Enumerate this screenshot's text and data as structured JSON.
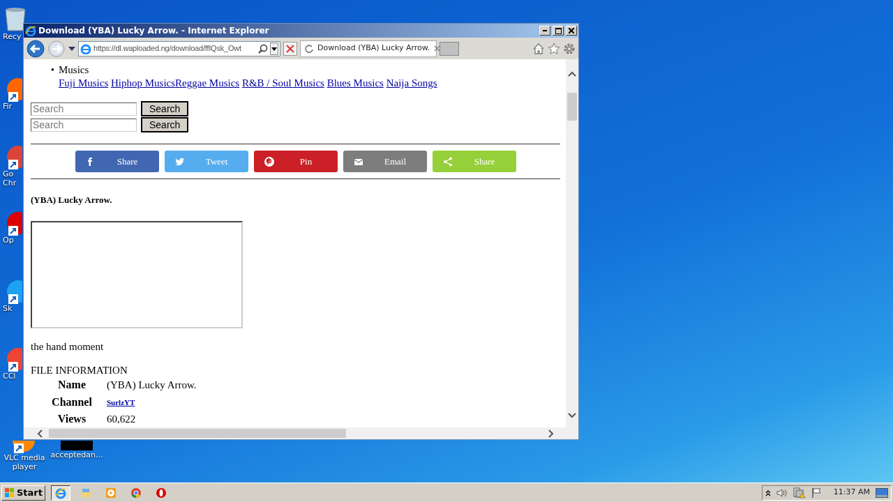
{
  "desktop_icons": [
    {
      "kind": "recycle",
      "lines": [
        "Recy"
      ]
    },
    {
      "kind": "firefox",
      "lines": [
        "Fir"
      ]
    },
    {
      "kind": "chrome",
      "lines": [
        "Go",
        "Chr"
      ]
    },
    {
      "kind": "opera",
      "lines": [
        "Op"
      ]
    },
    {
      "kind": "skype",
      "lines": [
        "Sk"
      ]
    },
    {
      "kind": "ccleaner",
      "lines": [
        "CCl"
      ]
    },
    {
      "kind": "vlc",
      "lines": [
        "VLC media",
        "player"
      ]
    },
    {
      "kind": "file",
      "lines": [
        "acceptedan..."
      ]
    }
  ],
  "window": {
    "title": "Download (YBA) Lucky Arrow. - Internet Explorer",
    "address": "https://dl.waploaded.ng/download/ffIQsk_Owt",
    "tabs": [
      {
        "label": "Download (YBA) Lucky Arrow.",
        "selected": true
      }
    ]
  },
  "page": {
    "menu": {
      "bullet": "•",
      "label": "Musics",
      "links": [
        {
          "text": "Fuji Musics",
          "joined": false
        },
        {
          "text": "Hiphop Musics",
          "joined": false
        },
        {
          "text": "Reggae Musics",
          "joined": true
        },
        {
          "text": "R&B / Soul Musics",
          "joined": false
        },
        {
          "text": "Blues Musics",
          "joined": false
        },
        {
          "text": "Naija Songs",
          "joined": false
        }
      ]
    },
    "search_forms": [
      {
        "placeholder": "Search",
        "button": "Search"
      },
      {
        "placeholder": "Search",
        "button": "Search"
      }
    ],
    "share_buttons": [
      {
        "kind": "facebook",
        "label": "Share",
        "color": "#4267b2"
      },
      {
        "kind": "twitter",
        "label": "Tweet",
        "color": "#55acee"
      },
      {
        "kind": "pinterest",
        "label": "Pin",
        "color": "#cb2027"
      },
      {
        "kind": "email",
        "label": "Email",
        "color": "#7d7d7d"
      },
      {
        "kind": "sharethis",
        "label": "Share",
        "color": "#95d03a"
      }
    ],
    "title": "(YBA) Lucky Arrow.",
    "description": "the hand moment",
    "file_info": {
      "heading": "FILE INFORMATION",
      "rows": [
        {
          "label": "Name",
          "value": "(YBA) Lucky Arrow.",
          "kind": "text"
        },
        {
          "label": "Channel",
          "value": "SurlzYT",
          "kind": "link"
        },
        {
          "label": "Views",
          "value": "60,622",
          "kind": "text"
        }
      ]
    }
  },
  "taskbar": {
    "start": "Start",
    "apps": [
      {
        "kind": "ie",
        "active": true
      },
      {
        "kind": "explorer",
        "active": false
      },
      {
        "kind": "media",
        "active": false
      },
      {
        "kind": "chrome",
        "active": false
      },
      {
        "kind": "opera",
        "active": false
      }
    ],
    "clock": "11:37 AM"
  }
}
